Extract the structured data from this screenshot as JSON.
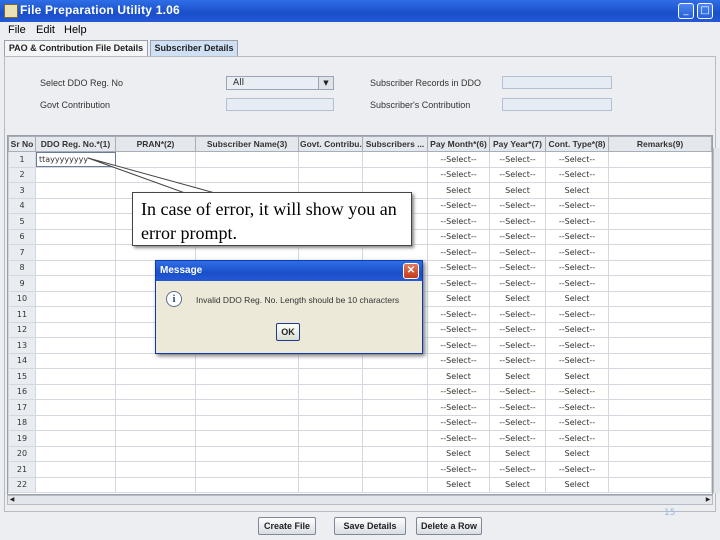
{
  "window": {
    "title": "File Preparation Utility 1.06"
  },
  "menu": [
    "File",
    "Edit",
    "Help"
  ],
  "tabs": [
    {
      "label": "PAO & Contribution File Details"
    },
    {
      "label": "Subscriber Details"
    }
  ],
  "form": {
    "ddo_label": "Select DDO Reg. No",
    "ddo_value": "All",
    "subscriber_records_label": "Subscriber Records in DDO",
    "govt_contribution_label": "Govt Contribution",
    "subscriber_contribution_label": "Subscriber's Contribution"
  },
  "table": {
    "columns": [
      "Sr No",
      "DDO Reg. No.*(1)",
      "PRAN*(2)",
      "Subscriber Name(3)",
      "Govt. Contribu...",
      "Subscribers ...",
      "Pay Month*(6)",
      "Pay Year*(7)",
      "Cont. Type*(8)",
      "Remarks(9)"
    ],
    "rows": [
      {
        "sr": "1",
        "ddo": "ttayyyyyyyy",
        "month": "--Select--",
        "year": "--Select--",
        "type": "--Select--"
      },
      {
        "sr": "2",
        "month": "--Select--",
        "year": "--Select--",
        "type": "--Select--"
      },
      {
        "sr": "3",
        "month": "Select",
        "year": "Select",
        "type": "Select"
      },
      {
        "sr": "4",
        "month": "--Select--",
        "year": "--Select--",
        "type": "--Select--"
      },
      {
        "sr": "5",
        "month": "--Select--",
        "year": "--Select--",
        "type": "--Select--"
      },
      {
        "sr": "6",
        "month": "--Select--",
        "year": "--Select--",
        "type": "--Select--"
      },
      {
        "sr": "7",
        "month": "--Select--",
        "year": "--Select--",
        "type": "--Select--"
      },
      {
        "sr": "8",
        "month": "--Select--",
        "year": "--Select--",
        "type": "--Select--"
      },
      {
        "sr": "9",
        "month": "--Select--",
        "year": "--Select--",
        "type": "--Select--"
      },
      {
        "sr": "10",
        "month": "Select",
        "year": "Select",
        "type": "Select"
      },
      {
        "sr": "11",
        "month": "--Select--",
        "year": "--Select--",
        "type": "--Select--"
      },
      {
        "sr": "12",
        "month": "--Select--",
        "year": "--Select--",
        "type": "--Select--"
      },
      {
        "sr": "13",
        "month": "--Select--",
        "year": "--Select--",
        "type": "--Select--"
      },
      {
        "sr": "14",
        "month": "--Select--",
        "year": "--Select--",
        "type": "--Select--"
      },
      {
        "sr": "15",
        "month": "Select",
        "year": "Select",
        "type": "Select"
      },
      {
        "sr": "16",
        "month": "--Select--",
        "year": "--Select--",
        "type": "--Select--"
      },
      {
        "sr": "17",
        "month": "--Select--",
        "year": "--Select--",
        "type": "--Select--"
      },
      {
        "sr": "18",
        "month": "--Select--",
        "year": "--Select--",
        "type": "--Select--"
      },
      {
        "sr": "19",
        "month": "--Select--",
        "year": "--Select--",
        "type": "--Select--"
      },
      {
        "sr": "20",
        "month": "Select",
        "year": "Select",
        "type": "Select"
      },
      {
        "sr": "21",
        "month": "--Select--",
        "year": "--Select--",
        "type": "--Select--"
      },
      {
        "sr": "22",
        "month": "Select",
        "year": "Select",
        "type": "Select"
      }
    ]
  },
  "buttons": {
    "create": "Create File",
    "save": "Save Details",
    "delete": "Delete a Row"
  },
  "callout": {
    "text": "In case of error, it will show you an error prompt."
  },
  "dialog": {
    "title": "Message",
    "message": "Invalid DDO Reg. No. Length should be 10 characters",
    "ok": "OK",
    "icon": "info-icon"
  },
  "slide_number": "15"
}
